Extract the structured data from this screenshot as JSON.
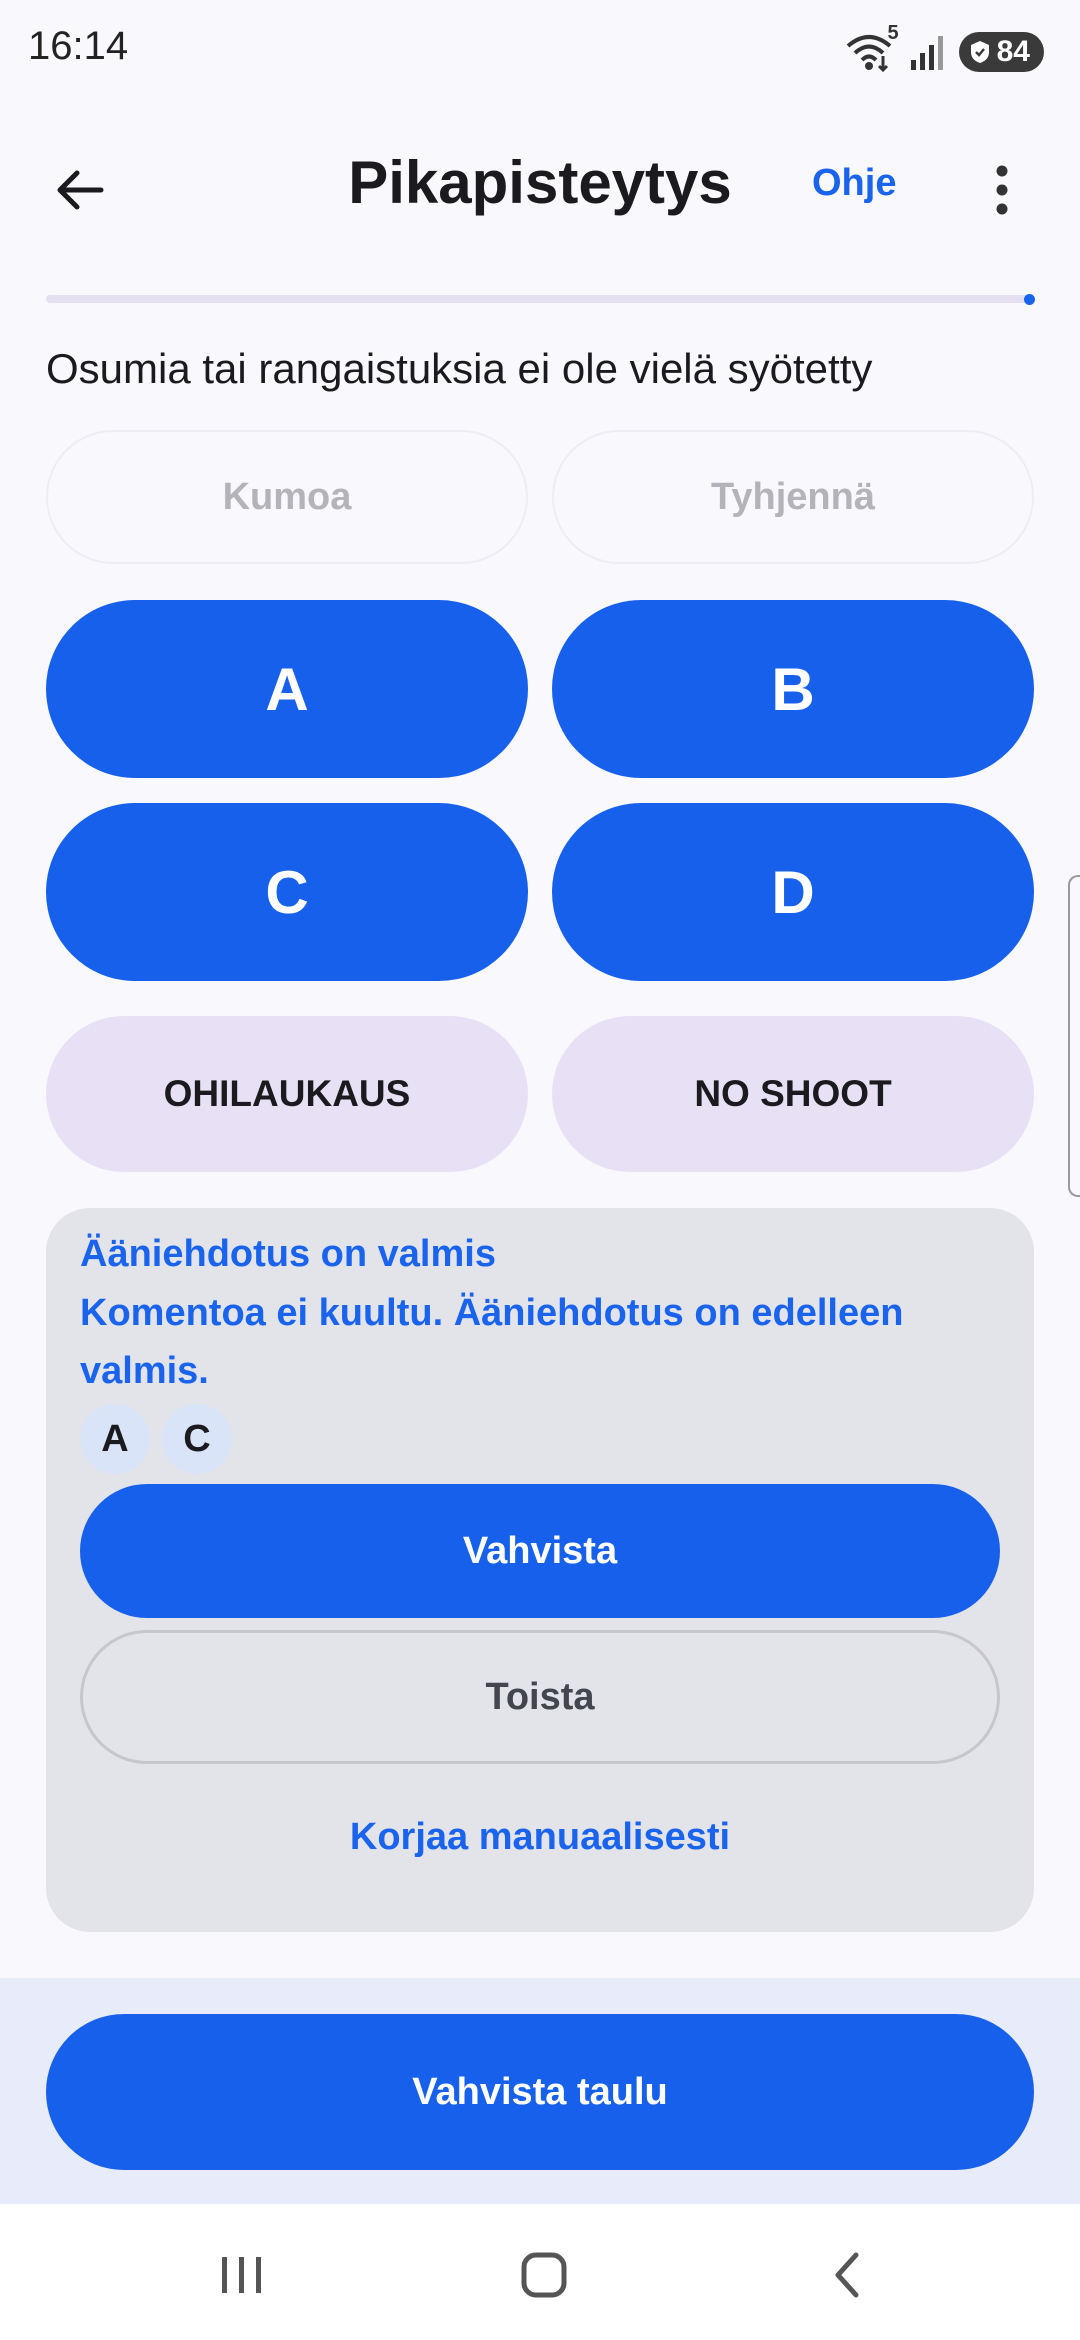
{
  "status_bar": {
    "time": "16:14",
    "wifi_badge": "5",
    "battery": "84",
    "icons": [
      "wifi-icon",
      "signal-icon",
      "battery-icon"
    ]
  },
  "app_bar": {
    "title": "Pikapisteytys",
    "help_label": "Ohje",
    "back_icon": "arrow-left-icon",
    "more_icon": "more-vertical-icon"
  },
  "progress": {
    "fraction": 1.0
  },
  "status_text": "Osumia tai rangaistuksia ei ole vielä syötetty",
  "actions": {
    "undo_label": "Kumoa",
    "clear_label": "Tyhjennä"
  },
  "zones": [
    "A",
    "B",
    "C",
    "D"
  ],
  "penalties": {
    "miss_label": "OHILAUKAUS",
    "no_shoot_label": "NO SHOOT"
  },
  "voice": {
    "ready_text": "Ääniehdotus on valmis",
    "message_line1": "Komentoa ei kuultu. Ääniehdotus on edelleen",
    "message_line2": "valmis.",
    "chips": [
      "A",
      "C"
    ],
    "confirm_label": "Vahvista",
    "replay_label": "Toista",
    "manual_label": "Korjaa manuaalisesti"
  },
  "board_confirm_label": "Vahvista taulu",
  "colors": {
    "primary": "#1760EC",
    "tonal": "#E8E0F5",
    "card": "#E3E3EA",
    "background": "#F9F8FD"
  },
  "nav": {
    "icons": [
      "recents-icon",
      "home-icon",
      "back-icon"
    ]
  }
}
